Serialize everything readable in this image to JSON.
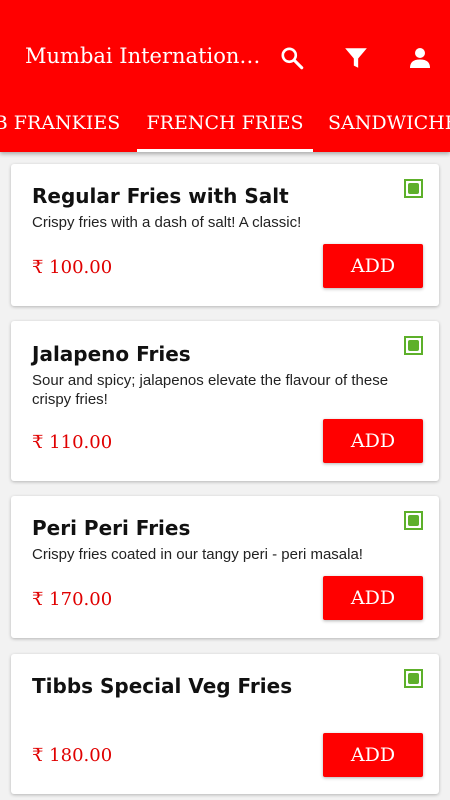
{
  "appbar": {
    "title": "Mumbai International Tibbs Frankie",
    "colors": {
      "primary": "#ff0000",
      "veg": "#5db02a"
    },
    "icons": [
      "search-icon",
      "filter-icon",
      "account-icon"
    ]
  },
  "tabs": [
    {
      "label": "B FRANKIES"
    },
    {
      "label": "FRENCH FRIES",
      "active": true
    },
    {
      "label": "SANDWICHES"
    }
  ],
  "items": [
    {
      "name": "Regular Fries with Salt",
      "description": "Crispy fries with a dash of salt! A classic!",
      "price": "₹ 100.00",
      "button": "ADD"
    },
    {
      "name": "Jalapeno Fries",
      "description": "Sour and spicy; jalapenos elevate the flavour of these crispy fries!",
      "price": "₹ 110.00",
      "button": "ADD"
    },
    {
      "name": "Peri Peri Fries",
      "description": "Crispy fries coated in our tangy peri - peri masala!",
      "price": "₹ 170.00",
      "button": "ADD"
    },
    {
      "name": "Tibbs Special Veg Fries",
      "description": "",
      "price": "₹ 180.00",
      "button": "ADD"
    }
  ]
}
